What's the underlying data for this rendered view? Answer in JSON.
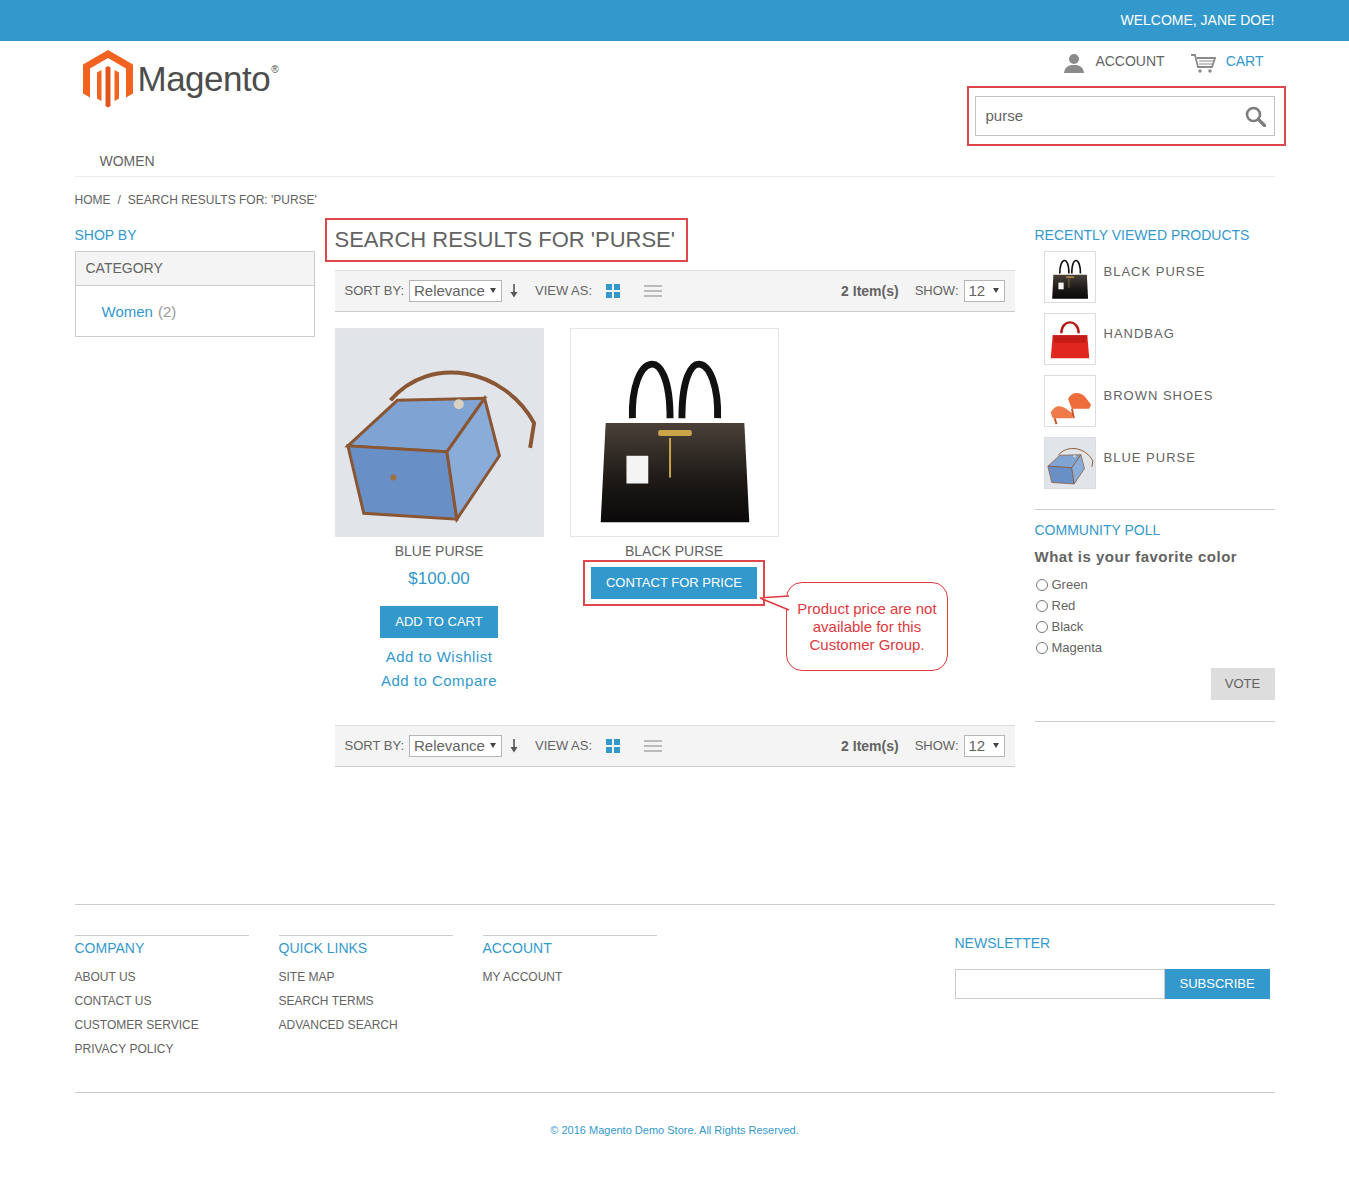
{
  "top_bar": {
    "welcome": "WELCOME, JANE DOE!"
  },
  "header": {
    "logo": "Magento",
    "logo_mark": "®",
    "account": "ACCOUNT",
    "cart": "CART"
  },
  "search": {
    "value": "purse",
    "highlighted": true
  },
  "nav": [
    {
      "label": "WOMEN"
    }
  ],
  "breadcrumb": [
    {
      "label": "HOME"
    },
    {
      "label": "/"
    },
    {
      "label": "SEARCH RESULTS FOR: 'PURSE'"
    }
  ],
  "sidebar": {
    "title": "SHOP BY",
    "section": "CATEGORY",
    "items": [
      {
        "label": "Women",
        "count": "(2)"
      }
    ]
  },
  "results": {
    "title": "SEARCH RESULTS FOR 'PURSE'",
    "highlighted": true
  },
  "toolbars": [
    {
      "sort_label": "SORT BY:",
      "sort_value": "Relevance",
      "view_label": "VIEW AS:",
      "view_modes": [
        {
          "kind": "grid",
          "selected": true
        },
        {
          "kind": "list",
          "selected": false
        }
      ],
      "count": "2 Item(s)",
      "show_label": "SHOW:",
      "show_value": "12"
    },
    {
      "sort_label": "SORT BY:",
      "sort_value": "Relevance",
      "view_label": "VIEW AS:",
      "view_modes": [
        {
          "kind": "grid",
          "selected": true
        },
        {
          "kind": "list",
          "selected": false
        }
      ],
      "count": "2 Item(s)",
      "show_label": "SHOW:",
      "show_value": "12"
    }
  ],
  "products": [
    {
      "name": "BLUE PURSE",
      "kind": "priced",
      "price": "$100.00",
      "button": "ADD TO CART",
      "highlighted": false,
      "links": [
        {
          "label": "Add to Wishlist"
        },
        {
          "label": "Add to Compare"
        }
      ]
    },
    {
      "name": "BLACK PURSE",
      "kind": "contact",
      "button": "CONTACT FOR PRICE",
      "highlighted": true,
      "callout": "Product price are not available for this Customer Group."
    }
  ],
  "recently_viewed": {
    "title": "RECENTLY VIEWED PRODUCTS",
    "items": [
      {
        "name": "BLACK PURSE"
      },
      {
        "name": "HANDBAG"
      },
      {
        "name": "BROWN SHOES"
      },
      {
        "name": "BLUE PURSE"
      }
    ]
  },
  "poll": {
    "title": "COMMUNITY POLL",
    "question": "What is your favorite color",
    "options": [
      {
        "label": "Green",
        "selected": false
      },
      {
        "label": "Red",
        "selected": false
      },
      {
        "label": "Black",
        "selected": false
      },
      {
        "label": "Magenta",
        "selected": false
      }
    ],
    "button": "VOTE"
  },
  "footer": {
    "columns": [
      {
        "title": "COMPANY",
        "links": [
          "ABOUT US",
          "CONTACT US",
          "CUSTOMER SERVICE",
          "PRIVACY POLICY"
        ]
      },
      {
        "title": "QUICK LINKS",
        "links": [
          "SITE MAP",
          "SEARCH TERMS",
          "ADVANCED SEARCH"
        ]
      },
      {
        "title": "ACCOUNT",
        "links": [
          "MY ACCOUNT"
        ]
      }
    ],
    "newsletter": {
      "title": "NEWSLETTER",
      "button": "SUBSCRIBE"
    },
    "copyright": "© 2016 Magento Demo Store. All Rights Reserved."
  }
}
